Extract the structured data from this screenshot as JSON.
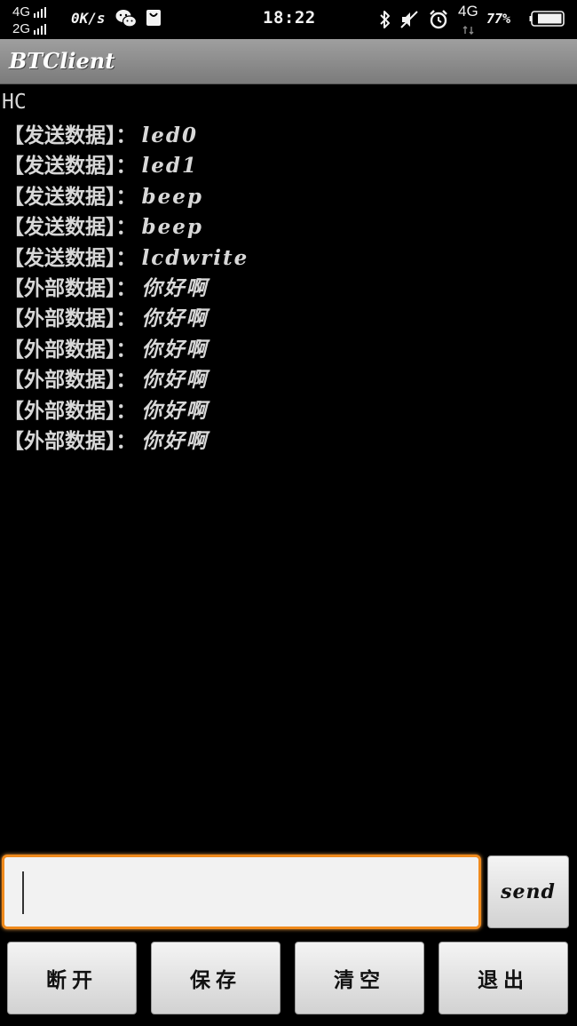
{
  "status_bar": {
    "network_top": "4G",
    "network_bottom": "2G",
    "speed": "0K/s",
    "time": "18:22",
    "network_right": "4G",
    "battery": "77%"
  },
  "app": {
    "title": "BTClient"
  },
  "log": {
    "device": "HC",
    "lines": [
      {
        "tag": "【发送数据】：",
        "msg": "led0"
      },
      {
        "tag": "【发送数据】：",
        "msg": "led1"
      },
      {
        "tag": "【发送数据】：",
        "msg": "beep"
      },
      {
        "tag": "【发送数据】：",
        "msg": "beep"
      },
      {
        "tag": "【发送数据】：",
        "msg": "lcdwrite"
      },
      {
        "tag": "【外部数据】：",
        "msg": "你好啊"
      },
      {
        "tag": "【外部数据】：",
        "msg": "你好啊"
      },
      {
        "tag": "【外部数据】：",
        "msg": "你好啊"
      },
      {
        "tag": "【外部数据】：",
        "msg": "你好啊"
      },
      {
        "tag": "【外部数据】：",
        "msg": "你好啊"
      },
      {
        "tag": "【外部数据】：",
        "msg": "你好啊"
      }
    ]
  },
  "input": {
    "value": "",
    "placeholder": ""
  },
  "buttons": {
    "send": "send",
    "disconnect": "断开",
    "save": "保存",
    "clear": "清空",
    "exit": "退出"
  },
  "colors": {
    "input_focus_border": "#f08a1c",
    "title_bar": "#8c8c8c",
    "background": "#000000"
  },
  "icons": [
    "signal-icon",
    "wechat-icon",
    "shopping-bag-icon",
    "bluetooth-icon",
    "mute-icon",
    "alarm-icon",
    "battery-icon"
  ]
}
